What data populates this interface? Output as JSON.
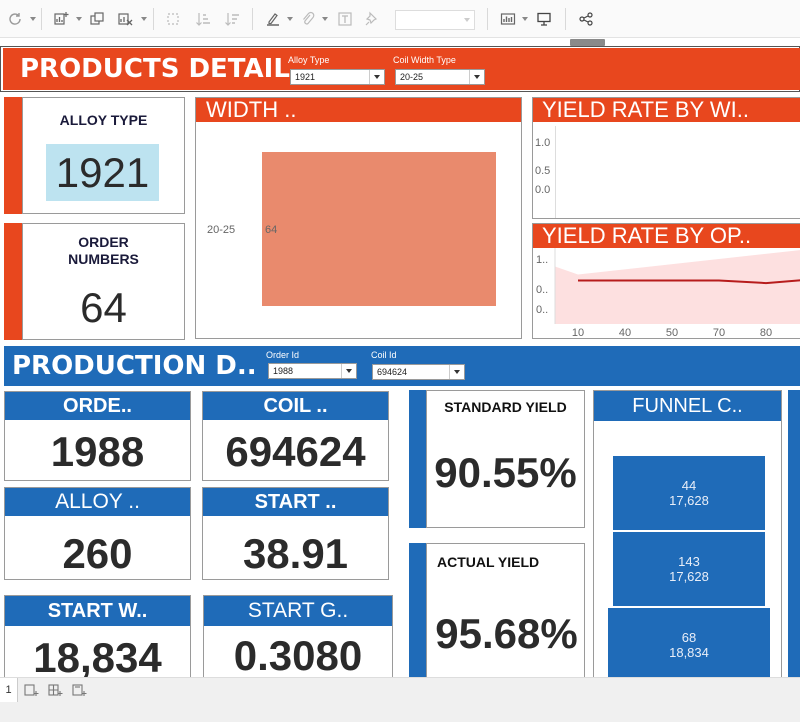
{
  "filters": {
    "alloy_type_label": "Alloy Type",
    "alloy_type_value": "1921",
    "coil_width_label": "Coil Width Type",
    "coil_width_value": "20-25",
    "order_id_label": "Order Id",
    "order_id_value": "1988",
    "coil_id_label": "Coil Id",
    "coil_id_value": "694624"
  },
  "products": {
    "title": "PRODUCTS DETAIL",
    "alloy_card_title": "ALLOY TYPE",
    "alloy_card_value": "1921",
    "orders_card_title_1": "ORDER",
    "orders_card_title_2": "NUMBERS",
    "orders_card_value": "64"
  },
  "width_chart": {
    "title": "WIDTH ..",
    "category_label": "20-25",
    "value_label": "64"
  },
  "yield_width_chart": {
    "title": "YIELD RATE BY WI..",
    "y_ticks": [
      "1.0",
      "0.5",
      "0.0"
    ]
  },
  "yield_op_chart": {
    "title": "YIELD RATE BY OP..",
    "y_ticks": [
      "1..",
      "0..",
      "0.."
    ],
    "x_ticks": [
      "10",
      "40",
      "50",
      "70",
      "80"
    ]
  },
  "production": {
    "title": "PRODUCTION D..",
    "order_head": "ORDE..",
    "order_value": "1988",
    "coil_head": "COIL ..",
    "coil_value": "694624",
    "alloy_head": "ALLOY ..",
    "alloy_value": "260",
    "start_head": "START ..",
    "start_value": "38.91",
    "start_w_head": "START W..",
    "start_w_value": "18,834",
    "start_g_head": "START G..",
    "start_g_value": "0.3080",
    "standard_yield_title": "STANDARD YIELD",
    "standard_yield_value": "90.55%",
    "actual_yield_title": "ACTUAL YIELD",
    "actual_yield_value": "95.68%",
    "funnel_title": "FUNNEL C..",
    "funnel": [
      {
        "top": "44",
        "bottom": "17,628"
      },
      {
        "top": "143",
        "bottom": "17,628"
      },
      {
        "top": "68",
        "bottom": "18,834"
      }
    ]
  },
  "footer": {
    "page_number": "1"
  },
  "chart_data": [
    {
      "type": "bar",
      "title": "WIDTH ..",
      "categories": [
        "20-25"
      ],
      "values": [
        64
      ]
    },
    {
      "type": "line",
      "title": "YIELD RATE BY OP..",
      "x": [
        "10",
        "40",
        "50",
        "70",
        "80"
      ],
      "series": [
        {
          "values": [
            0.99,
            0.99,
            0.99,
            0.99,
            0.93
          ]
        }
      ],
      "ylabel": ""
    }
  ],
  "colors": {
    "accent_orange": "#e8471e",
    "accent_blue": "#1f6bb8",
    "bar_fill": "#e98a6d",
    "line": "#b71c1c"
  }
}
